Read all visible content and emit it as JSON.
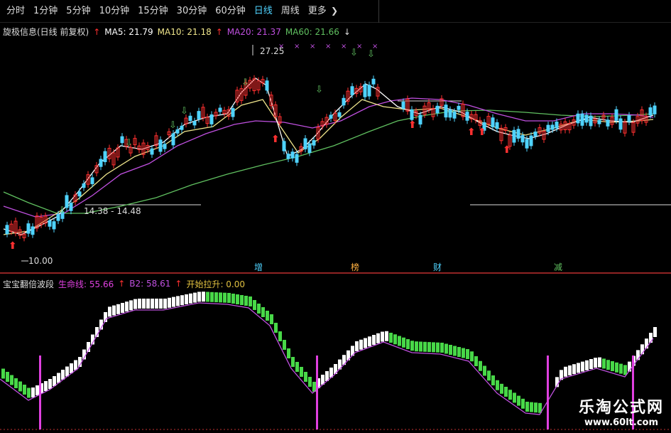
{
  "toolbar": {
    "items": [
      "分时",
      "1分钟",
      "5分钟",
      "10分钟",
      "15分钟",
      "30分钟",
      "60分钟",
      "日线",
      "周线",
      "更多"
    ],
    "active_index": 7,
    "more_icon": "chevron-right-icon"
  },
  "main_indicator": {
    "title": "旋极信息(日线 前复权)",
    "ma5": "MA5: 21.79",
    "ma10": "MA10: 21.18",
    "ma20": "MA20: 21.37",
    "ma60": "MA60: 21.66",
    "ma5_arrow": "↑",
    "ma20_arrow": "↑",
    "ma60_arrow": "↓"
  },
  "price_labels": {
    "high": "27.25",
    "low": "10.00",
    "range": "14.38 - 14.48"
  },
  "bottom_markers": [
    "增",
    "榜",
    "财",
    "减"
  ],
  "sub_indicator": {
    "title": "宝宝翻倍波段",
    "life_line": "生命线: 55.66",
    "b2": "B2: 58.61",
    "start_pull": "开始拉升: 0.00",
    "life_arrow": "↑",
    "b2_arrow": "↑"
  },
  "watermark": {
    "title": "乐淘公式网",
    "url": "www.60lt.com"
  },
  "colors": {
    "up": "#ff3030",
    "down": "#4fd3ff",
    "ma5": "#ffffff",
    "ma10": "#f0e68c",
    "ma20": "#c050e0",
    "ma60": "#60c060",
    "green_bar": "#48d848",
    "white_bar": "#ffffff",
    "magenta": "#e040e0",
    "divider": "#c03030"
  }
}
